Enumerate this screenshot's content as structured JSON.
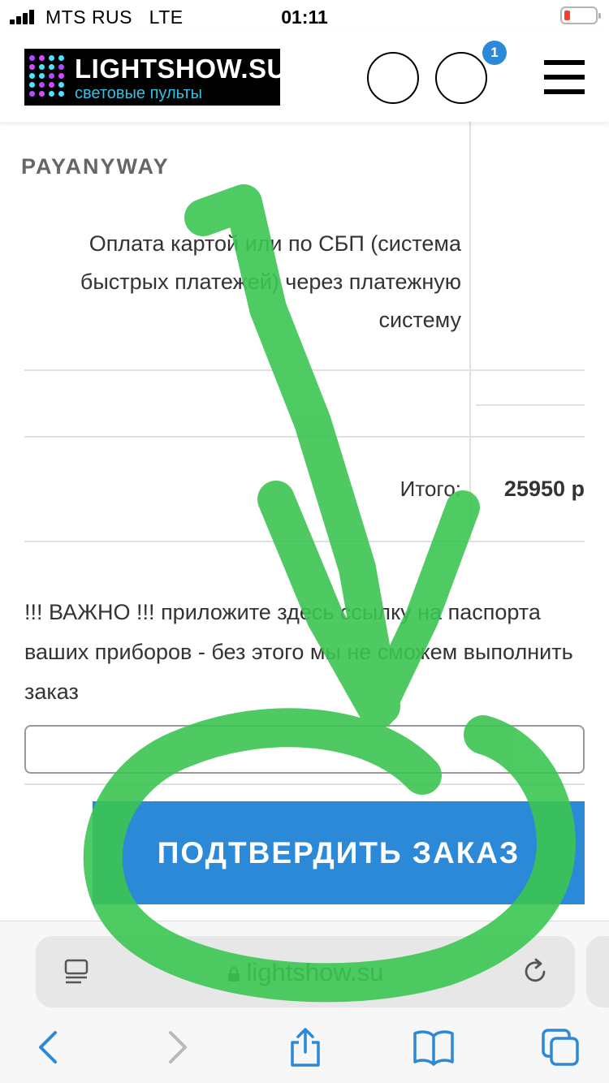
{
  "status_bar": {
    "carrier": "MTS RUS   LTE",
    "time": "01:11"
  },
  "header": {
    "logo_title": "LIGHTSHOW.SU",
    "logo_subtitle": "световые пульты",
    "cart_count": "1"
  },
  "payment": {
    "provider": "PAYANYWAY",
    "description": "Оплата картой или по СБП (система быстрых платежей) через платежную систему"
  },
  "total": {
    "label": "Итого:",
    "value": "25950 р"
  },
  "notice": {
    "text": "!!! ВАЖНО !!! приложите здесь ссылку на паспорта ваших приборов - без этого мы не сможем выполнить заказ"
  },
  "link_input": {
    "value": "",
    "placeholder": ""
  },
  "confirm_button": {
    "label": "ПОДТВЕРДИТЬ ЗАКАЗ"
  },
  "browser": {
    "url": "lightshow.su"
  },
  "colors": {
    "accent": "#2b89d8",
    "annotation": "#3cc552",
    "logo_bg": "#000000",
    "logo_sub": "#2ec3e6"
  }
}
